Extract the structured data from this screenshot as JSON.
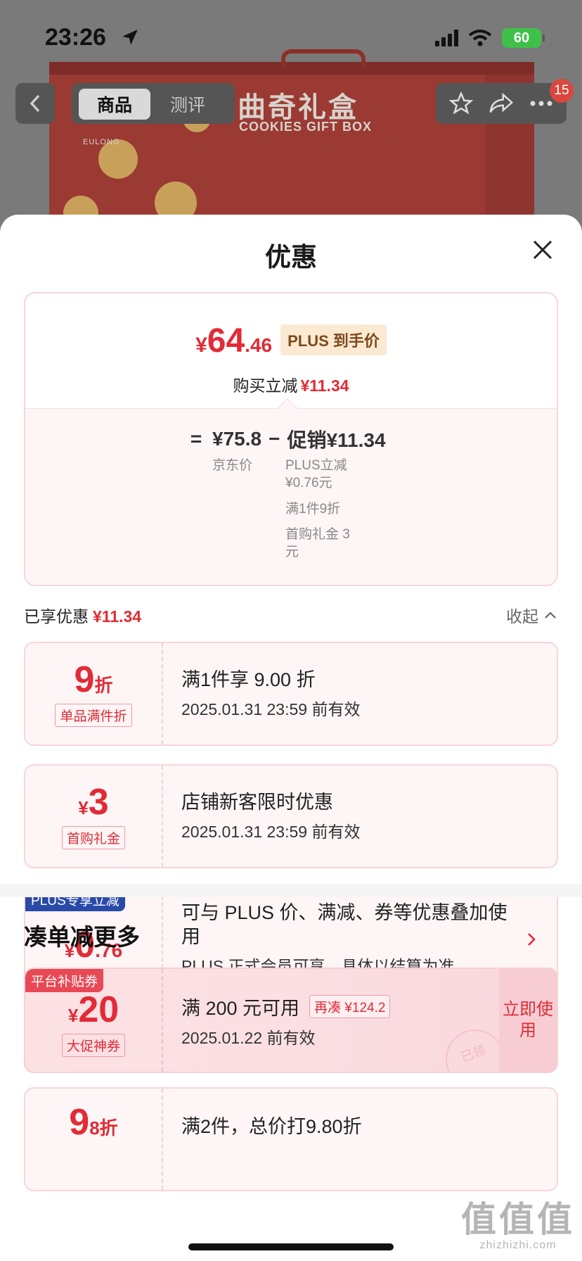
{
  "status": {
    "time": "23:26",
    "battery": "60"
  },
  "nav": {
    "tabs": [
      "商品",
      "测评"
    ],
    "cart_badge": "15"
  },
  "product_image": {
    "title": "曲奇礼盒",
    "subtitle": "COOKIES GIFT BOX",
    "brand": "EULONG"
  },
  "sheet": {
    "title": "优惠",
    "final_price": {
      "symbol": "¥",
      "integer": "64",
      "decimal": ".46"
    },
    "price_tag": "PLUS 到手价",
    "saved_label": "购买立减",
    "saved_value": "¥11.34",
    "formula": {
      "eq": "=",
      "base_price": "¥75.8",
      "base_label": "京东价",
      "minus": "−",
      "promo": "促销¥11.34",
      "promo_details": [
        "PLUS立减 ¥0.76元",
        "满1件9折",
        "首购礼金 3元"
      ]
    },
    "enjoyed_label": "已享优惠",
    "enjoyed_value": "¥11.34",
    "collapse_label": "收起"
  },
  "coupons": [
    {
      "big_num": "9",
      "big_unit": "折",
      "label": "单品满件折",
      "title": "满1件享 9.00 折",
      "sub": "2025.01.31 23:59 前有效"
    },
    {
      "big_sym": "¥",
      "big_num": "3",
      "label": "首购礼金",
      "title": "店铺新客限时优惠",
      "sub": "2025.01.31 23:59 前有效"
    },
    {
      "corner": "PLUS专享立减",
      "big_sym": "¥",
      "big_num": "0",
      "big_dec": ".76",
      "title": "可与 PLUS 价、满减、券等优惠叠加使用",
      "sub": "PLUS 正式会员可享，具体以结算为准"
    }
  ],
  "more": {
    "title": "凑单减更多",
    "promo": {
      "corner": "平台补贴券",
      "big_sym": "¥",
      "big_num": "20",
      "label": "大促神券",
      "title": "满 200 元可用",
      "again": "再凑 ¥124.2",
      "sub": "2025.01.22 前有效",
      "button": "立即使用",
      "stamp": "已领"
    },
    "partial": {
      "big_num": "9",
      "big_unit": "8折",
      "title": "满2件，总价打9.80折"
    }
  },
  "watermark": {
    "big": "值值值",
    "small": "zhizhizhi.com"
  },
  "colors": {
    "accent_red": "#e12b36",
    "plus_blue": "#2a4aa8",
    "plus_gold_bg": "#fbe9d2"
  }
}
